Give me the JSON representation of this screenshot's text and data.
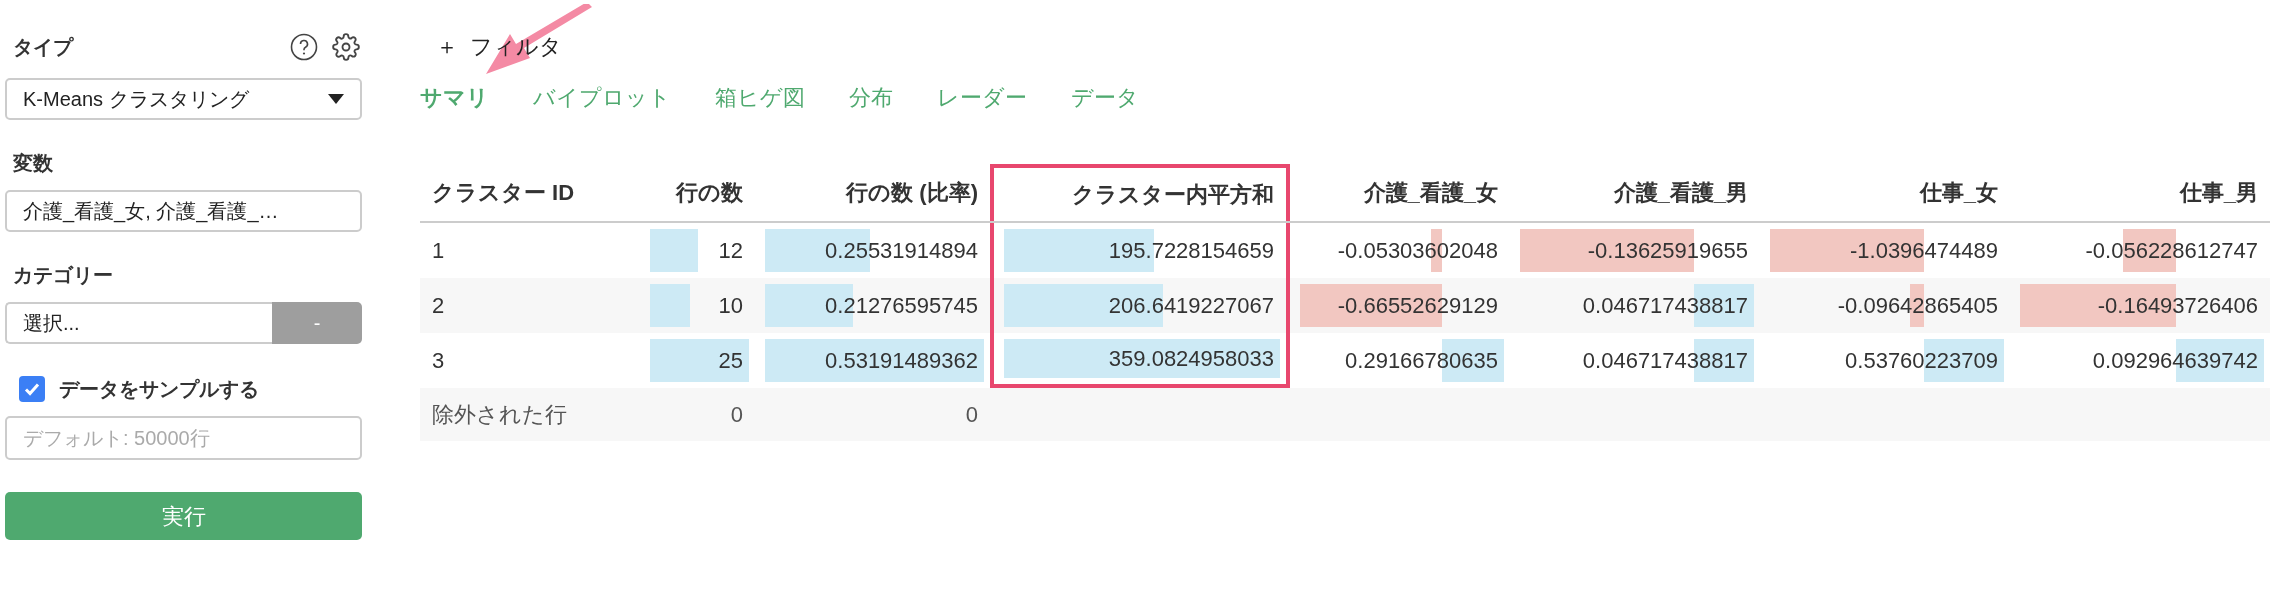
{
  "sidebar": {
    "type_label": "タイプ",
    "type_select": "K-Means クラスタリング",
    "variables_label": "変数",
    "variables_field": "介護_看護_女, 介護_看護_…",
    "category_label": "カテゴリー",
    "category_select": "選択...",
    "category_button": "-",
    "sample_checkbox": {
      "label": "データをサンプルする",
      "checked": true
    },
    "sample_field": {
      "placeholder": "デフォルト: 50000行"
    },
    "run_button": "実行"
  },
  "filter": {
    "icon": "＋",
    "label": "フィルタ"
  },
  "tabs": [
    {
      "label": "サマリ",
      "selected": true
    },
    {
      "label": "バイプロット",
      "selected": false
    },
    {
      "label": "箱ヒゲ図",
      "selected": false
    },
    {
      "label": "分布",
      "selected": false
    },
    {
      "label": "レーダー",
      "selected": false
    },
    {
      "label": "データ",
      "selected": false
    }
  ],
  "table": {
    "columns": [
      {
        "label": "クラスター ID",
        "highlighted": false
      },
      {
        "label": "行の数",
        "highlighted": false
      },
      {
        "label": "行の数 (比率)",
        "highlighted": false
      },
      {
        "label": "クラスター内平方和",
        "highlighted": true
      },
      {
        "label": "介護_看護_女",
        "highlighted": false
      },
      {
        "label": "介護_看護_男",
        "highlighted": false
      },
      {
        "label": "仕事_女",
        "highlighted": false
      },
      {
        "label": "仕事_男",
        "highlighted": false
      }
    ],
    "rows": [
      {
        "cells": [
          {
            "text": "1"
          },
          {
            "text": "12"
          },
          {
            "text": "0.25531914894"
          },
          {
            "text": "195.7228154659"
          },
          {
            "text": "-0.05303602048"
          },
          {
            "text": "-0.13625919655"
          },
          {
            "text": "-1.0396474489"
          },
          {
            "text": "-0.056228612747"
          }
        ]
      },
      {
        "cells": [
          {
            "text": "2"
          },
          {
            "text": "10"
          },
          {
            "text": "0.21276595745"
          },
          {
            "text": "206.6419227067"
          },
          {
            "text": "-0.66552629129"
          },
          {
            "text": "0.046717438817"
          },
          {
            "text": "-0.09642865405"
          },
          {
            "text": "-0.16493726406"
          }
        ]
      },
      {
        "cells": [
          {
            "text": "3"
          },
          {
            "text": "25"
          },
          {
            "text": "0.53191489362"
          },
          {
            "text": "359.0824958033"
          },
          {
            "text": "0.29166780635"
          },
          {
            "text": "0.046717438817"
          },
          {
            "text": "0.53760223709"
          },
          {
            "text": "0.092964639742"
          }
        ]
      }
    ],
    "footer": {
      "cells": [
        {
          "text": "除外された行"
        },
        {
          "text": "0"
        },
        {
          "text": "0"
        }
      ]
    }
  },
  "annotations": [
    {
      "kind": "arrow"
    }
  ]
}
